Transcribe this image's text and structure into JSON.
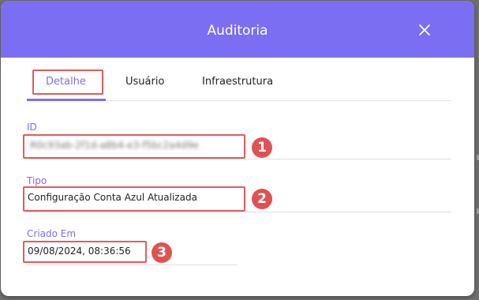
{
  "dialog": {
    "title": "Auditoria"
  },
  "tabs": [
    {
      "label": "Detalhe",
      "active": true
    },
    {
      "label": "Usuário",
      "active": false
    },
    {
      "label": "Infraestrutura",
      "active": false
    }
  ],
  "fields": {
    "id": {
      "label": "ID",
      "value": "R0c93ab-2f1d-a8b4-e3-f5bc2a4d9e"
    },
    "tipo": {
      "label": "Tipo",
      "value": "Configuração Conta Azul Atualizada"
    },
    "criado_em": {
      "label": "Criado Em",
      "value": "09/08/2024, 08:36:56"
    }
  },
  "annotations": [
    "1",
    "2",
    "3"
  ],
  "colors": {
    "accent": "#7c6ef2",
    "highlight": "#e25c5c",
    "badge": "#e05252"
  },
  "icons": {
    "close": "close-icon"
  }
}
